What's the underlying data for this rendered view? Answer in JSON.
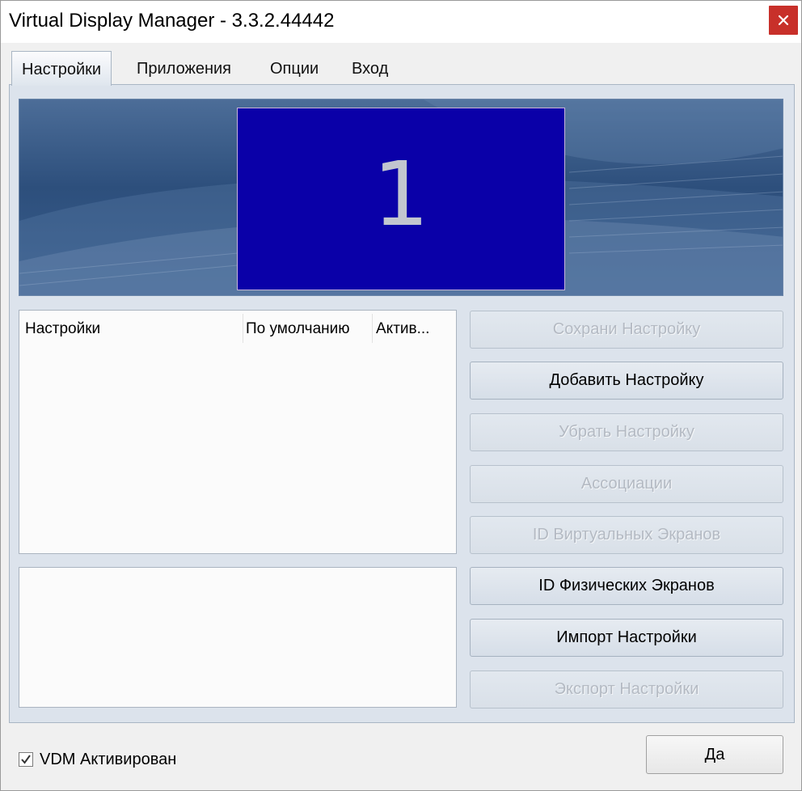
{
  "window": {
    "title": "Virtual Display Manager - 3.3.2.44442"
  },
  "tabs": [
    {
      "label": "Настройки",
      "active": true
    },
    {
      "label": "Приложения",
      "active": false
    },
    {
      "label": "Опции",
      "active": false
    },
    {
      "label": "Вход",
      "active": false
    }
  ],
  "preview": {
    "monitor_number": "1"
  },
  "list": {
    "columns": [
      "Настройки",
      "По умолчанию",
      "Актив..."
    ],
    "rows": []
  },
  "buttons": {
    "save": {
      "label": "Сохрани Настройку",
      "enabled": false
    },
    "add": {
      "label": "Добавить Настройку",
      "enabled": true
    },
    "remove": {
      "label": "Убрать Настройку",
      "enabled": false
    },
    "associations": {
      "label": "Ассоциации",
      "enabled": false
    },
    "virtual_ids": {
      "label": "ID Виртуальных Экранов",
      "enabled": false
    },
    "physical_ids": {
      "label": "ID Физических Экранов",
      "enabled": true
    },
    "import": {
      "label": "Импорт Настройки",
      "enabled": true
    },
    "export": {
      "label": "Экспорт Настройки",
      "enabled": false
    },
    "ok": {
      "label": "Да"
    }
  },
  "vdm_active": {
    "label": "VDM Активирован",
    "checked": true
  },
  "colors": {
    "monitor_fill": "#0a00a8",
    "close_button": "#c8302a",
    "panel_bg": "#dce3ec"
  }
}
